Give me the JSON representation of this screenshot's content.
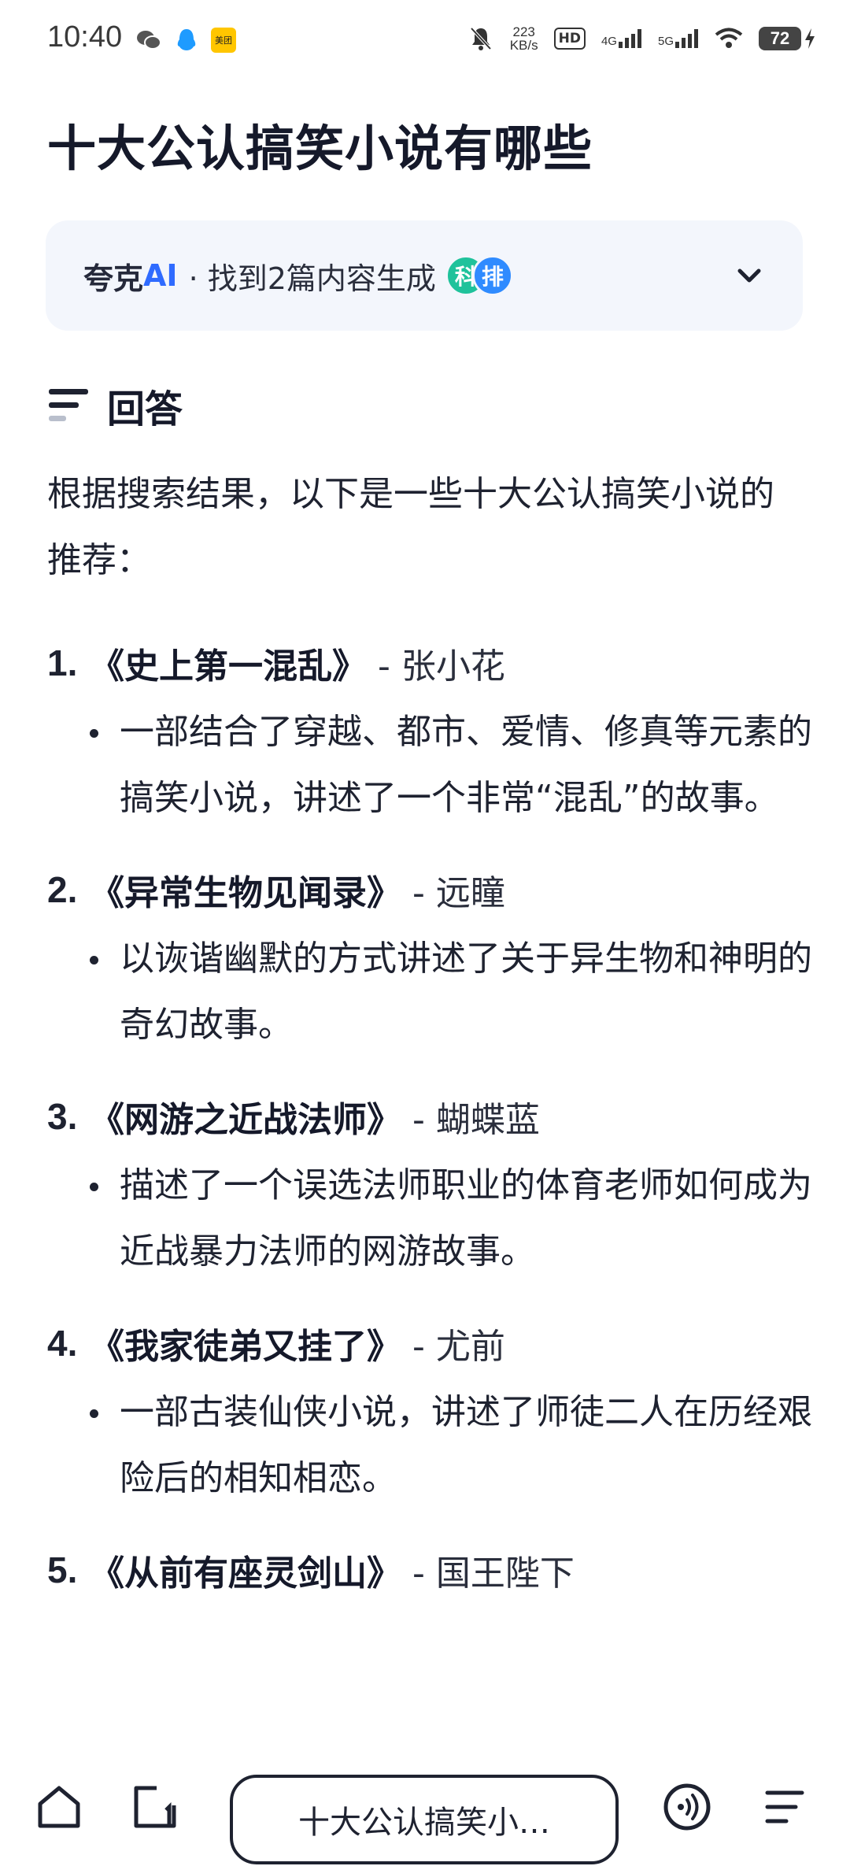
{
  "status_bar": {
    "time": "10:40",
    "net_speed_value": "223",
    "net_speed_unit": "KB/s",
    "hd_label": "HD",
    "sig1_label": "4G",
    "sig2_label": "5G",
    "battery": "72",
    "meituan_label": "美团"
  },
  "page": {
    "title": "十大公认搞笑小说有哪些"
  },
  "source_card": {
    "brand": "夸克",
    "brand_ai": "AI",
    "text": "· 找到2篇内容生成",
    "avatar1": "科",
    "avatar2": "排"
  },
  "answer": {
    "label": "回答",
    "intro": "根据搜索结果，以下是一些十大公认搞笑小说的推荐：",
    "items": [
      {
        "num": "1.",
        "title": "《史上第一混乱》",
        "author": "- 张小花",
        "desc": "一部结合了穿越、都市、爱情、修真等元素的搞笑小说，讲述了一个非常“混乱”的故事。"
      },
      {
        "num": "2.",
        "title": "《异常生物见闻录》",
        "author": "- 远瞳",
        "desc": "以诙谐幽默的方式讲述了关于异生物和神明的奇幻故事。"
      },
      {
        "num": "3.",
        "title": "《网游之近战法师》",
        "author": "- 蝴蝶蓝",
        "desc": "描述了一个误选法师职业的体育老师如何成为近战暴力法师的网游故事。"
      },
      {
        "num": "4.",
        "title": "《我家徒弟又挂了》",
        "author": "- 尤前",
        "desc": "一部古装仙侠小说，讲述了师徒二人在历经艰险后的相知相恋。"
      },
      {
        "num": "5.",
        "title": "《从前有座灵剑山》",
        "author": "- 国王陛下",
        "desc": ""
      }
    ]
  },
  "bottom_bar": {
    "search_text": "十大公认搞笑小…"
  }
}
